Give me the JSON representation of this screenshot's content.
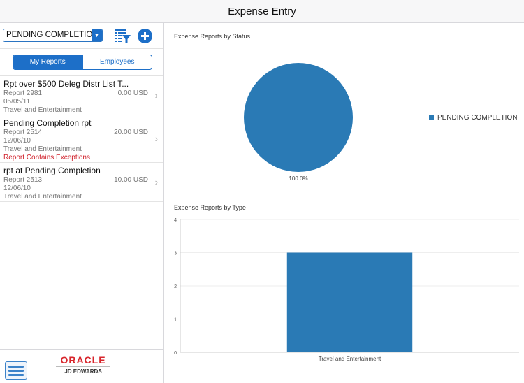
{
  "window": {
    "title": "Expense Entry"
  },
  "toolbar": {
    "status_select": "PENDING COMPLETION",
    "filter_icon": "list-filter-icon",
    "add_icon": "plus-circle-icon"
  },
  "segments": {
    "my_reports": "My Reports",
    "employees": "Employees"
  },
  "reports": [
    {
      "title": "Rpt over $500 Deleg Distr List T...",
      "number": "Report 2981",
      "amount": "0.00 USD",
      "date": "05/05/11",
      "type": "Travel and Entertainment",
      "exception": ""
    },
    {
      "title": "Pending Completion rpt",
      "number": "Report 2514",
      "amount": "20.00 USD",
      "date": "12/06/10",
      "type": "Travel and Entertainment",
      "exception": "Report Contains Exceptions"
    },
    {
      "title": "rpt at Pending Completion",
      "number": "Report 2513",
      "amount": "10.00 USD",
      "date": "12/06/10",
      "type": "Travel and Entertainment",
      "exception": ""
    }
  ],
  "footer": {
    "brand": "ORACLE",
    "product": "JD EDWARDS",
    "menu_icon": "hamburger-icon"
  },
  "colors": {
    "accent": "#1d6fc8",
    "series": "#2a7ab5",
    "error": "#d0202a"
  },
  "chart_data": [
    {
      "type": "pie",
      "title": "Expense Reports by Status",
      "labels": [
        "PENDING COMPLETION"
      ],
      "values": [
        100.0
      ],
      "data_labels": [
        "100.0%"
      ],
      "legend": "right"
    },
    {
      "type": "bar",
      "title": "Expense Reports by Type",
      "categories": [
        "Travel and Entertainment"
      ],
      "values": [
        3
      ],
      "ylim": [
        0,
        4
      ],
      "yticks": [
        0,
        1,
        2,
        3,
        4
      ],
      "grid": true,
      "xlabel": "",
      "ylabel": ""
    }
  ]
}
